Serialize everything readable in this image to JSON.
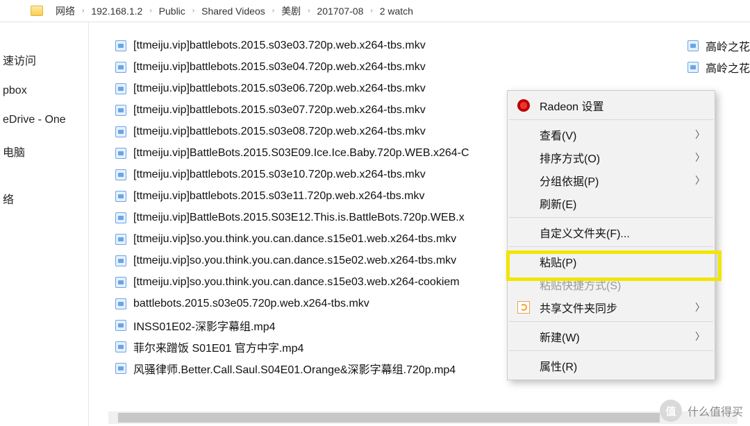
{
  "breadcrumb": [
    "网络",
    "192.168.1.2",
    "Public",
    "Shared Videos",
    "美剧",
    "201707-08",
    "2 watch"
  ],
  "sidebar": {
    "items": [
      {
        "label": "速访问"
      },
      {
        "label": "pbox"
      },
      {
        "label": "eDrive - One"
      },
      {
        "label": "电脑"
      },
      {
        "label": "络"
      }
    ]
  },
  "files": [
    "[ttmeiju.vip]battlebots.2015.s03e03.720p.web.x264-tbs.mkv",
    "[ttmeiju.vip]battlebots.2015.s03e04.720p.web.x264-tbs.mkv",
    "[ttmeiju.vip]battlebots.2015.s03e06.720p.web.x264-tbs.mkv",
    "[ttmeiju.vip]battlebots.2015.s03e07.720p.web.x264-tbs.mkv",
    "[ttmeiju.vip]battlebots.2015.s03e08.720p.web.x264-tbs.mkv",
    "[ttmeiju.vip]BattleBots.2015.S03E09.Ice.Ice.Baby.720p.WEB.x264-C",
    "[ttmeiju.vip]battlebots.2015.s03e10.720p.web.x264-tbs.mkv",
    "[ttmeiju.vip]battlebots.2015.s03e11.720p.web.x264-tbs.mkv",
    "[ttmeiju.vip]BattleBots.2015.S03E12.This.is.BattleBots.720p.WEB.x",
    "[ttmeiju.vip]so.you.think.you.can.dance.s15e01.web.x264-tbs.mkv",
    "[ttmeiju.vip]so.you.think.you.can.dance.s15e02.web.x264-tbs.mkv",
    "[ttmeiju.vip]so.you.think.you.can.dance.s15e03.web.x264-cookiem",
    "battlebots.2015.s03e05.720p.web.x264-tbs.mkv",
    "INSS01E02-深影字幕组.mp4",
    "菲尔来蹭饭 S01E01 官方中字.mp4",
    "风骚律师.Better.Call.Saul.S04E01.Orange&深影字幕组.720p.mp4"
  ],
  "right_files": [
    "高岭之花",
    "高岭之花"
  ],
  "context_menu": {
    "radeon": "Radeon 设置",
    "view": "查看(V)",
    "sort": "排序方式(O)",
    "group": "分组依据(P)",
    "refresh": "刷新(E)",
    "customize": "自定义文件夹(F)...",
    "paste": "粘贴(P)",
    "paste_shortcut": "粘贴快捷方式(S)",
    "sync": "共享文件夹同步",
    "new": "新建(W)",
    "properties": "属性(R)"
  },
  "watermark": {
    "badge": "值",
    "text": "什么值得买"
  }
}
